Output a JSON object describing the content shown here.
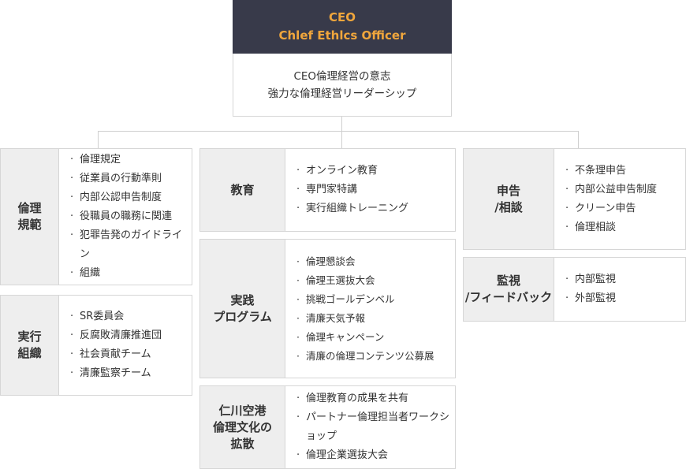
{
  "ceo": {
    "title": "CEO",
    "subtitle": "Chlef Ethlcs Officer",
    "desc_line1": "CEO倫理経営の意志",
    "desc_line2": "強力な倫理経営リーダーシップ"
  },
  "sections": {
    "rinri_kihan": {
      "head": [
        "倫理",
        "規範"
      ],
      "items": [
        "倫理規定",
        "従業員の行動準則",
        "内部公認申告制度",
        "役職員の職務に関連",
        "犯罪告発のガイドライン",
        "組織"
      ]
    },
    "jikko_soshiki": {
      "head": [
        "実行",
        "組織"
      ],
      "items": [
        "SR委員会",
        "反腐敗清廉推進団",
        "社会貢献チーム",
        "清廉監察チーム"
      ]
    },
    "kyoiku": {
      "head": [
        "教育"
      ],
      "items": [
        "オンライン教育",
        "専門家特講",
        "実行組織トレーニング"
      ]
    },
    "jissen": {
      "head": [
        "実践",
        "プログラム"
      ],
      "items": [
        "倫理懇談会",
        "倫理王選抜大会",
        "挑戦ゴールデンベル",
        "清廉天気予報",
        "倫理キャンペーン",
        "清廉の倫理コンテンツ公募展"
      ]
    },
    "kakusan": {
      "head": [
        "仁川空港",
        "倫理文化の",
        "拡散"
      ],
      "items": [
        "倫理教育の成果を共有",
        "パートナー倫理担当者ワークショップ",
        "倫理企業選抜大会"
      ]
    },
    "shinkoku": {
      "head": [
        "申告",
        "/相談"
      ],
      "items": [
        "不条理申告",
        "内部公益申告制度",
        "クリーン申告",
        "倫理相談"
      ]
    },
    "kanshi": {
      "head": [
        "監視",
        "/フィードバック"
      ],
      "items": [
        "内部監視",
        "外部監視"
      ]
    }
  }
}
